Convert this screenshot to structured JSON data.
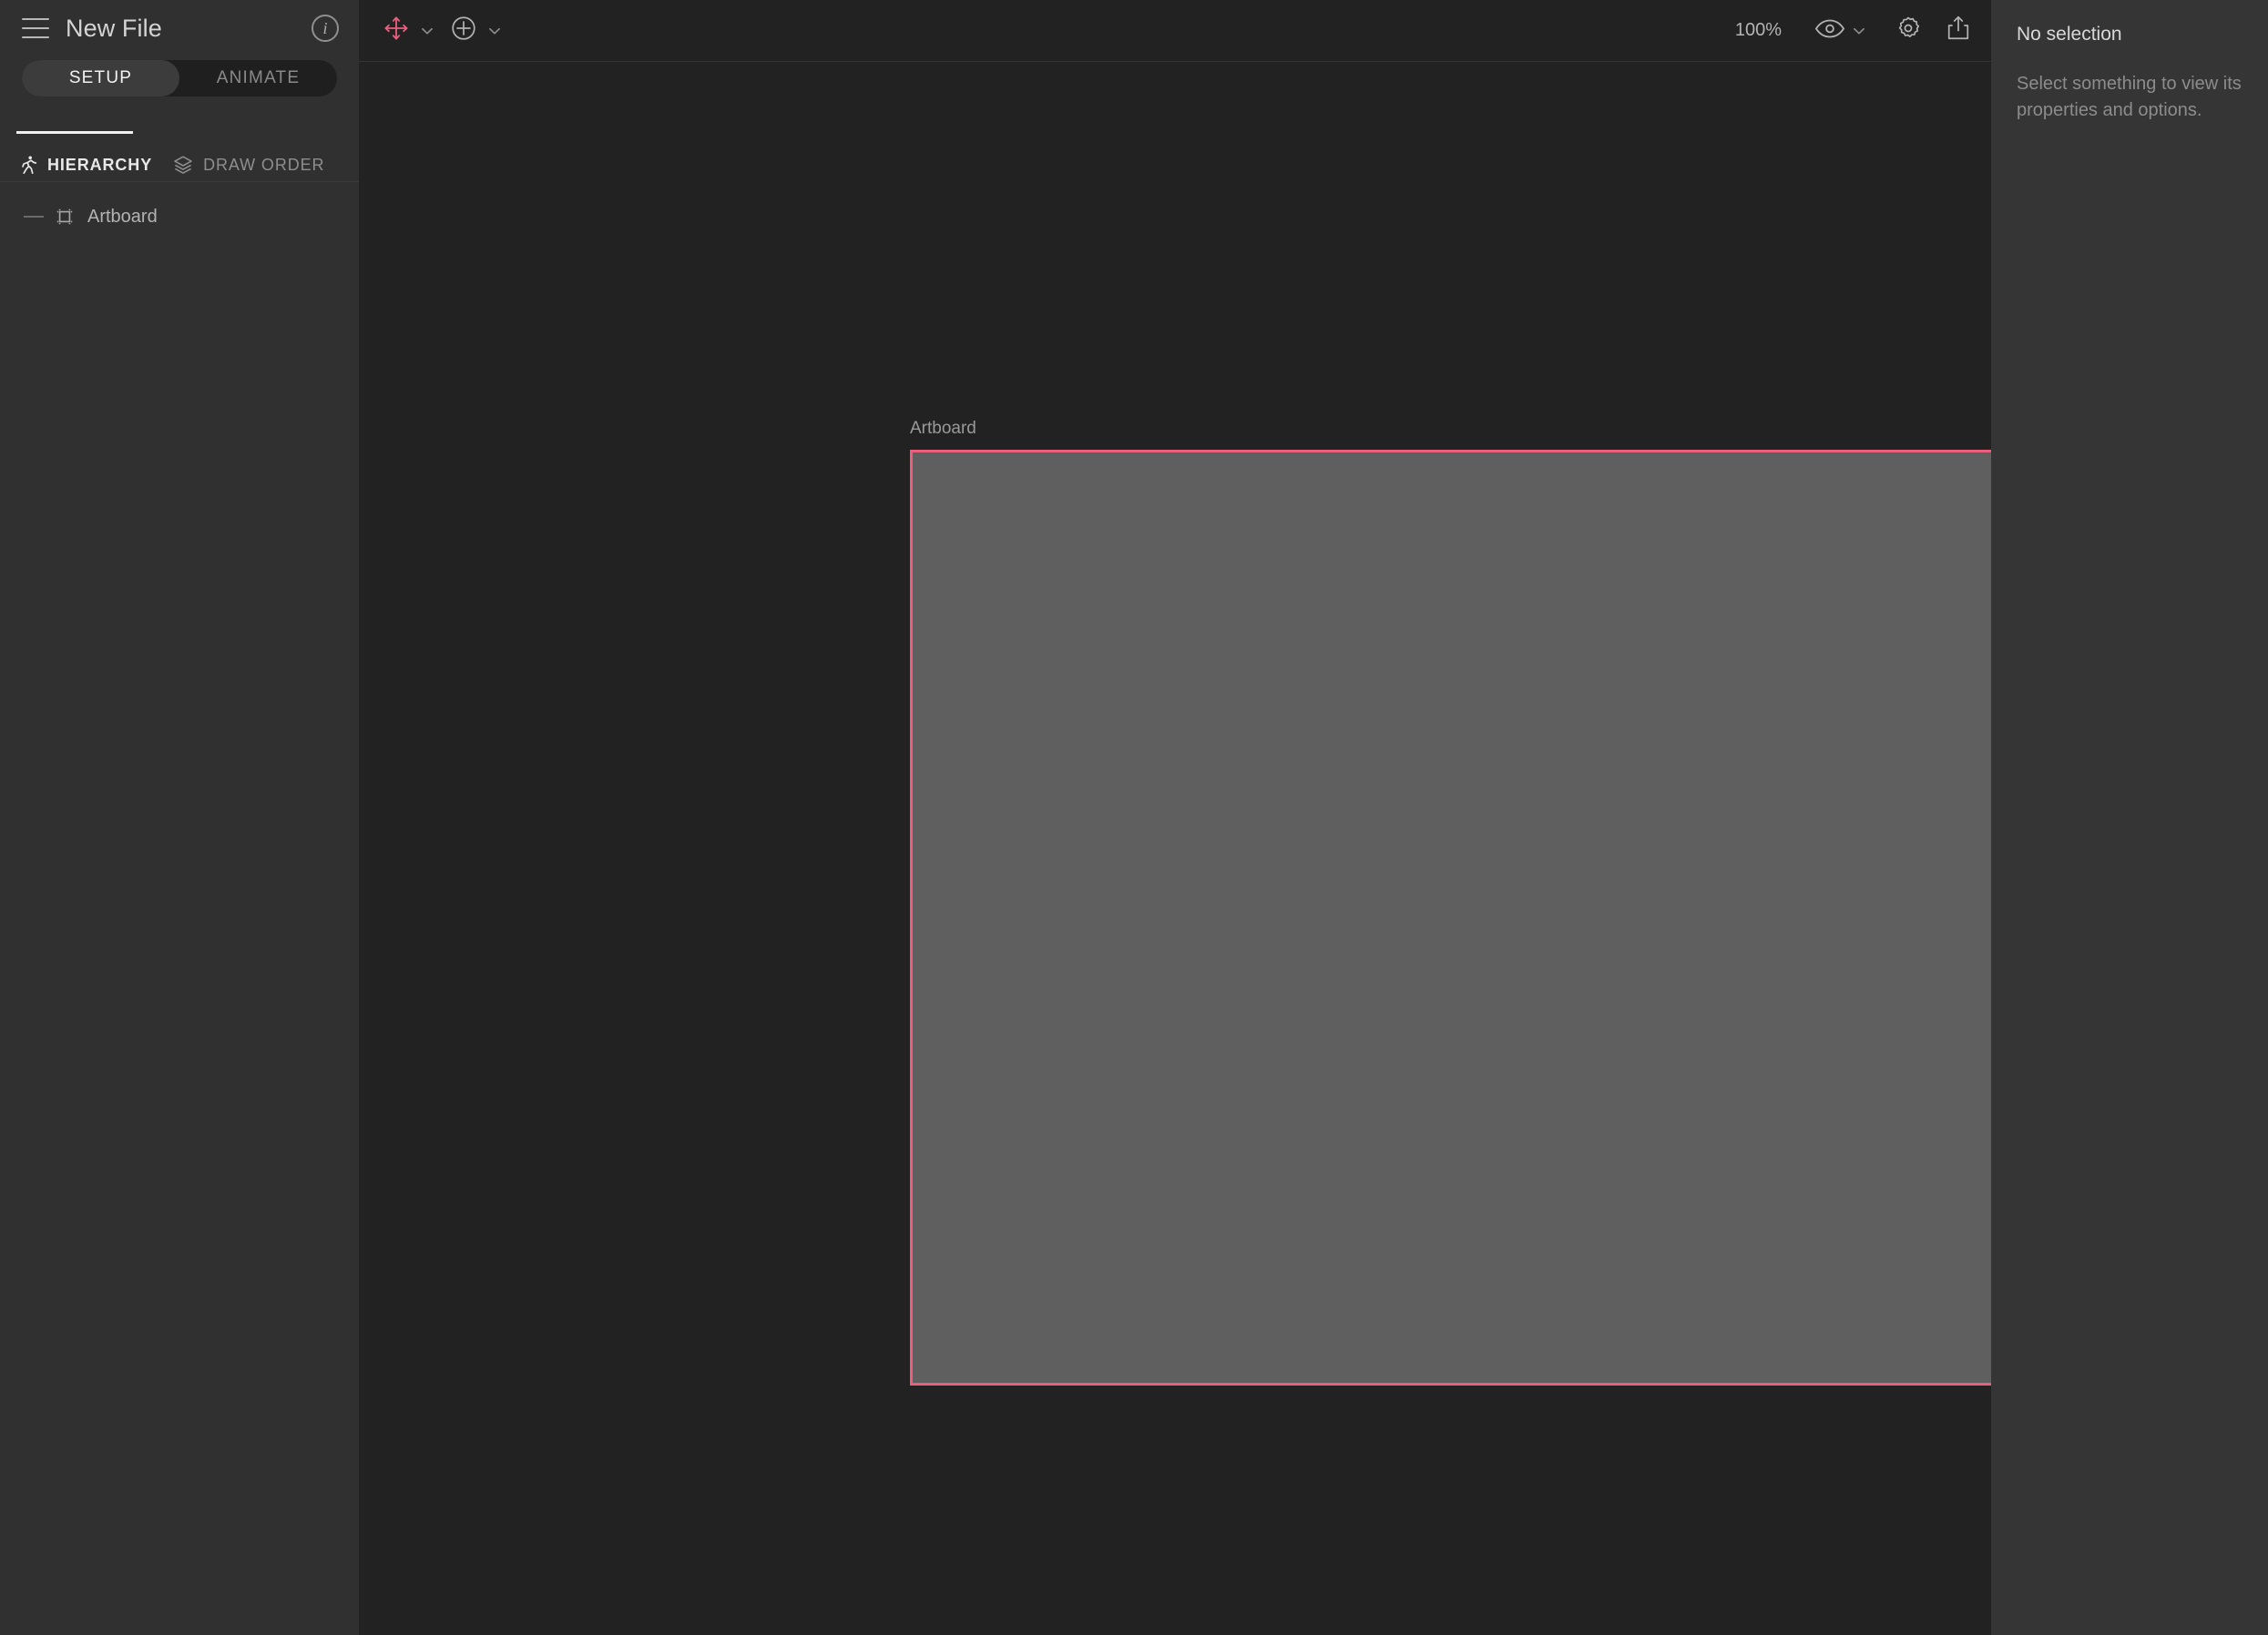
{
  "app": {
    "accent_color": "#ea5f7e",
    "sidebar_bg": "#303030",
    "canvas_bg": "#222222",
    "inspector_bg": "#353535",
    "artboard_fill": "#5f5f5f"
  },
  "sidebar": {
    "menu_icon": "hamburger-icon",
    "file_name": "New File",
    "info_icon": "info-icon",
    "mode_tabs": [
      {
        "label": "SETUP",
        "active": true
      },
      {
        "label": "ANIMATE",
        "active": false
      }
    ],
    "panel_tabs": [
      {
        "label": "HIERARCHY",
        "icon": "running-person-icon",
        "active": true
      },
      {
        "label": "DRAW ORDER",
        "icon": "layers-icon",
        "active": false
      }
    ],
    "tree": [
      {
        "label": "Artboard",
        "icon": "artboard-icon",
        "depth": 0
      }
    ]
  },
  "toolbar": {
    "translate_tool": {
      "name": "translate-tool",
      "icon": "four-way-arrow-icon",
      "active": true
    },
    "translate_chevron": "chevron-down-icon",
    "create_tool": {
      "name": "create-tool",
      "icon": "plus-circle-icon"
    },
    "create_chevron": "chevron-down-icon",
    "zoom_level": "100%",
    "visibility_icon": "eye-icon",
    "visibility_chevron": "chevron-down-icon",
    "settings_icon": "gear-icon",
    "share_icon": "share-export-icon"
  },
  "canvas": {
    "artboard_label": "Artboard"
  },
  "inspector": {
    "title": "No selection",
    "hint": "Select something to view its properties and options."
  }
}
